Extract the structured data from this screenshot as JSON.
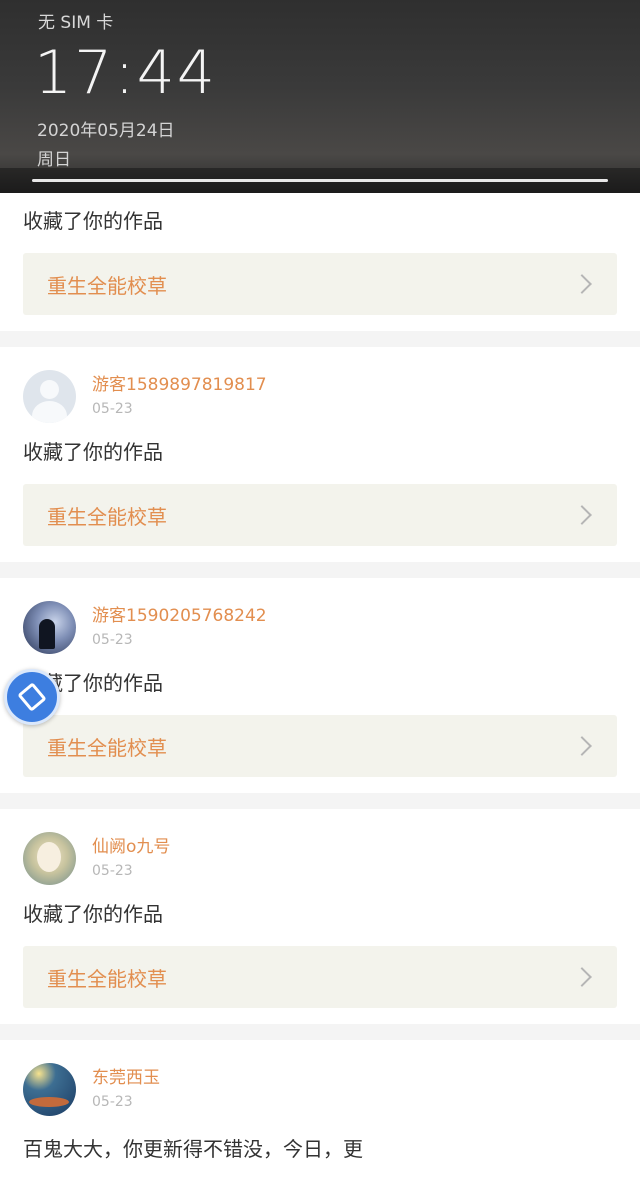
{
  "lockscreen": {
    "carrier": "无 SIM 卡",
    "time": "17:44",
    "date": "2020年05月24日",
    "weekday": "周日"
  },
  "feed": {
    "first": {
      "action": "收藏了你的作品",
      "book_title": "重生全能校草"
    },
    "items": [
      {
        "username": "游客1589897819817",
        "date": "05-23",
        "action": "收藏了你的作品",
        "book_title": "重生全能校草"
      },
      {
        "username": "游客1590205768242",
        "date": "05-23",
        "action": "收藏了你的作品",
        "book_title": "重生全能校草"
      },
      {
        "username": "仙阙o九号",
        "date": "05-23",
        "action": "收藏了你的作品",
        "book_title": "重生全能校草"
      }
    ],
    "last": {
      "username": "东莞西玉",
      "date": "05-23",
      "comment": "百鬼大大，你更新得不错没，今日，更"
    }
  },
  "floating_button": {
    "icon": "edit-icon"
  },
  "colors": {
    "accent": "#e28e4f",
    "card_bg": "#f3f3ec",
    "float": "#3d7ee0"
  }
}
